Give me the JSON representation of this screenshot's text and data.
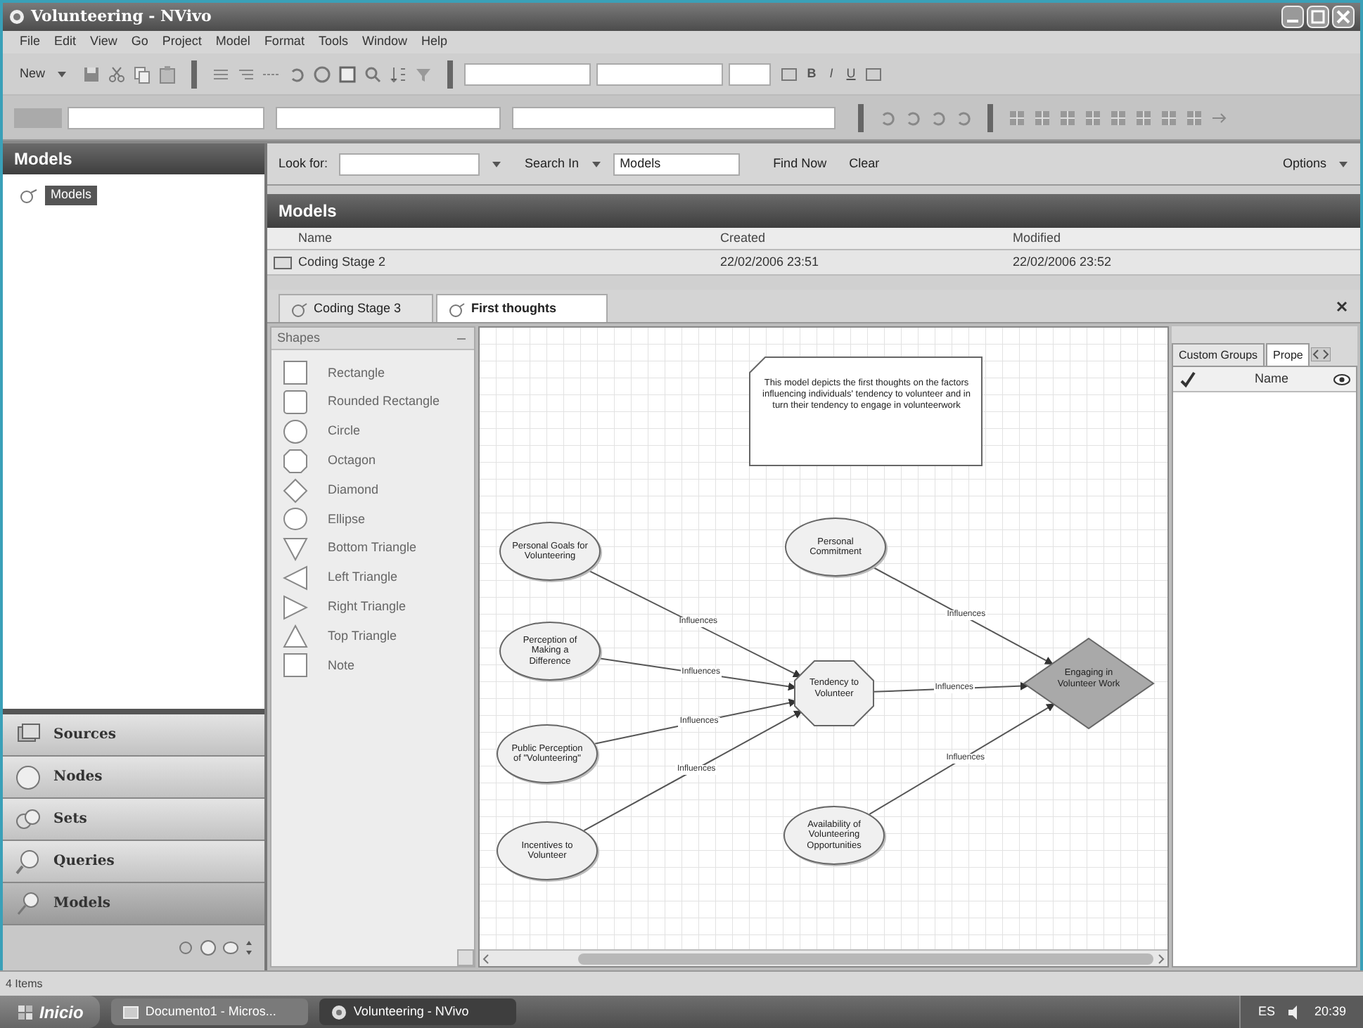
{
  "window": {
    "title": "Volunteering - NVivo"
  },
  "menu": [
    "File",
    "Edit",
    "View",
    "Go",
    "Project",
    "Model",
    "Format",
    "Tools",
    "Window",
    "Help"
  ],
  "toolbar": {
    "new_label": "New",
    "format_buttons": [
      "B",
      "I",
      "U"
    ]
  },
  "navigation": {
    "title": "Models",
    "tree": [
      {
        "label": "Models",
        "selected": true
      }
    ],
    "buttons": [
      {
        "label": "Sources",
        "selected": false
      },
      {
        "label": "Nodes",
        "selected": false
      },
      {
        "label": "Sets",
        "selected": false
      },
      {
        "label": "Queries",
        "selected": false
      },
      {
        "label": "Models",
        "selected": true
      }
    ]
  },
  "find_bar": {
    "look_for_label": "Look for:",
    "search_in_label": "Search In",
    "search_in_value": "Models",
    "find_now": "Find Now",
    "clear": "Clear",
    "options": "Options"
  },
  "list": {
    "title": "Models",
    "columns": [
      "Name",
      "Created",
      "Modified"
    ],
    "rows": [
      [
        "Coding Stage 2",
        "22/02/2006 23:51",
        "22/02/2006 23:52"
      ]
    ]
  },
  "tabs": [
    {
      "label": "Coding Stage 3",
      "selected": false
    },
    {
      "label": "First thoughts",
      "selected": true
    }
  ],
  "shapes_panel": {
    "title": "Shapes",
    "items": [
      {
        "label": "Rectangle",
        "kind": "rectangle"
      },
      {
        "label": "Rounded Rectangle",
        "kind": "rounded"
      },
      {
        "label": "Circle",
        "kind": "circle"
      },
      {
        "label": "Octagon",
        "kind": "octagon"
      },
      {
        "label": "Diamond",
        "kind": "diamond"
      },
      {
        "label": "Ellipse",
        "kind": "ellipse"
      },
      {
        "label": "Bottom Triangle",
        "kind": "triangle-down"
      },
      {
        "label": "Left Triangle",
        "kind": "triangle-left"
      },
      {
        "label": "Right Triangle",
        "kind": "triangle-right"
      },
      {
        "label": "Top Triangle",
        "kind": "triangle-up"
      },
      {
        "label": "Note",
        "kind": "note"
      }
    ]
  },
  "diagram": {
    "note": "This model depicts the first thoughts on the factors influencing individuals' tendency to volunteer and in turn their tendency to engage in volunteerwork",
    "nodes": [
      {
        "kind": "ellipse",
        "label": "Personal Goals for Volunteering"
      },
      {
        "kind": "ellipse",
        "label": "Personal Commitment"
      },
      {
        "kind": "ellipse",
        "label": "Perception of Making a Difference"
      },
      {
        "kind": "diamond",
        "label": "Engaging in Volunteer Work"
      },
      {
        "kind": "octagon",
        "label": "Tendency to Volunteer"
      },
      {
        "kind": "ellipse",
        "label": "Public Perception of \"Volunteering\""
      },
      {
        "kind": "ellipse",
        "label": "Availability of Volunteering Opportunities"
      },
      {
        "kind": "ellipse",
        "label": "Incentives to Volunteer"
      }
    ],
    "edges": [
      {
        "label": "Influences"
      },
      {
        "label": "Influences"
      },
      {
        "label": "Influences"
      },
      {
        "label": "Influences"
      },
      {
        "label": "Influences"
      },
      {
        "label": "Influences"
      },
      {
        "label": "Influences"
      }
    ]
  },
  "properties_panel": {
    "tabs": [
      {
        "label": "Custom Groups",
        "selected": false
      },
      {
        "label": "Prope",
        "selected": true
      }
    ],
    "columns": [
      "Name"
    ]
  },
  "status_bar": "4 Items",
  "taskbar": {
    "start": "Inicio",
    "tasks": [
      {
        "label": "Documento1 - Micros...",
        "selected": false
      },
      {
        "label": "Volunteering - NVivo",
        "selected": true
      }
    ],
    "language": "ES",
    "clock": "20:39"
  }
}
